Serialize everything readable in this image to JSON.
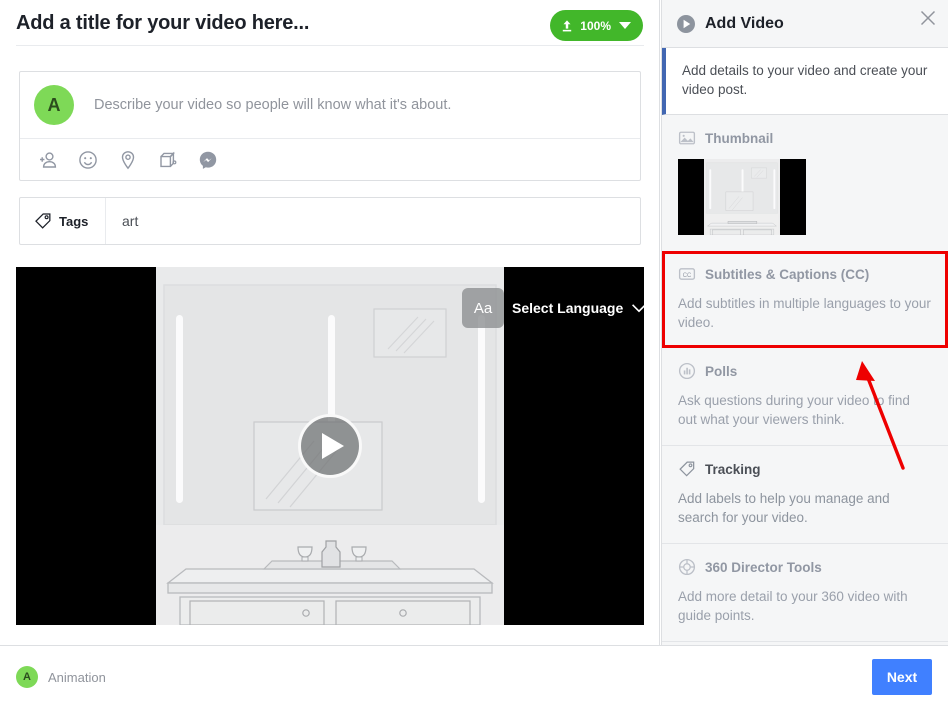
{
  "header": {
    "title_placeholder": "Add a title for your video here...",
    "upload_percent": "100%",
    "upload_icon": "upload-arrow-icon",
    "caret_icon": "chevron-down-icon"
  },
  "composer": {
    "avatar_initial": "A",
    "description_placeholder": "Describe your video so people will know what it's about.",
    "tools": [
      {
        "name": "tag-person-icon"
      },
      {
        "name": "emoji-icon"
      },
      {
        "name": "location-pin-icon"
      },
      {
        "name": "offer-gift-icon"
      },
      {
        "name": "messenger-icon"
      }
    ]
  },
  "tags": {
    "label": "Tags",
    "icon": "tag-icon",
    "value": "art"
  },
  "player": {
    "language_selector_label": "Select Language",
    "aa_glyph": "Aa",
    "play_icon": "play-button-icon",
    "chevron_icon": "chevron-down-icon"
  },
  "panel": {
    "title": "Add Video",
    "title_icon": "play-circle-icon",
    "close_icon": "close-icon",
    "intro": "Add details to your video and create your video post.",
    "accent_color": "#4267b2",
    "highlight_color": "#ee0000",
    "sections": [
      {
        "id": "thumbnail",
        "title": "Thumbnail",
        "icon": "image-icon",
        "desc": "",
        "state": "dim"
      },
      {
        "id": "subtitles",
        "title": "Subtitles & Captions (CC)",
        "icon": "cc-icon",
        "desc": "Add subtitles in multiple languages to your video.",
        "state": "dim"
      },
      {
        "id": "polls",
        "title": "Polls",
        "icon": "poll-bars-icon",
        "desc": "Ask questions during your video to find out what your viewers think.",
        "state": "dim"
      },
      {
        "id": "tracking",
        "title": "Tracking",
        "icon": "tag-icon",
        "desc": "Add labels to help you manage and search for your video.",
        "state": "lit"
      },
      {
        "id": "director",
        "title": "360 Director Tools",
        "icon": "globe-crosshair-icon",
        "desc": "Add more detail to your 360 video with guide points.",
        "state": "dim"
      }
    ]
  },
  "footer": {
    "avatar_initial": "A",
    "account_name": "Animation",
    "next_label": "Next",
    "next_color": "#4080ff"
  }
}
